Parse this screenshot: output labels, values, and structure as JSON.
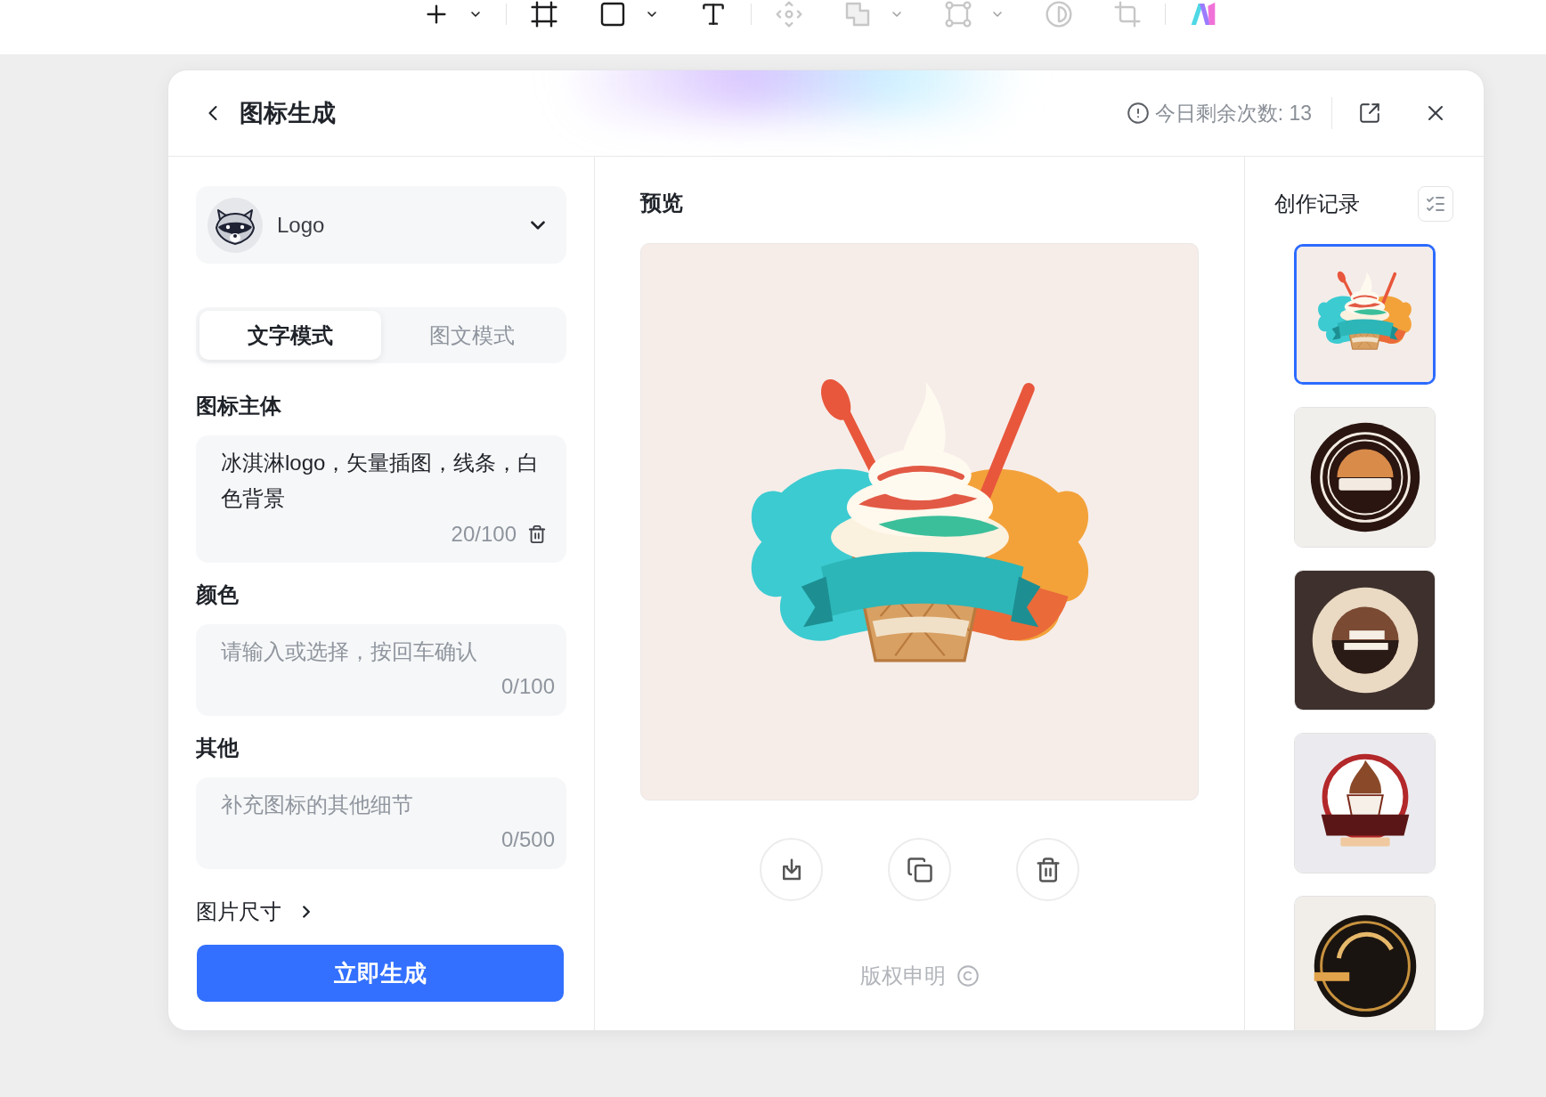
{
  "toolbar": {
    "groups": [
      {
        "tools": [
          {
            "menu": true,
            "disabled": false
          }
        ]
      },
      {
        "tools": [
          {
            "disabled": false
          },
          {
            "menu": true,
            "disabled": false
          },
          {
            "disabled": false
          }
        ]
      },
      {
        "tools": [
          {
            "disabled": true
          },
          {
            "menu": true,
            "disabled": true
          },
          {
            "menu": true,
            "disabled": true
          },
          {
            "disabled": true
          },
          {
            "disabled": true
          }
        ]
      },
      {
        "tools": [
          {
            "disabled": false
          }
        ]
      }
    ]
  },
  "dialog": {
    "title": "图标生成",
    "quota": "今日剩余次数: 13"
  },
  "form": {
    "style_select": {
      "value": "Logo"
    },
    "mode_tabs": [
      {
        "label": "文字模式",
        "selected": true
      },
      {
        "label": "图文模式",
        "selected": false
      }
    ],
    "fields": [
      {
        "label": "图标主体",
        "value": "冰淇淋logo，矢量插图，线条，白色背景",
        "counter": "20/100",
        "clearable": true
      },
      {
        "label": "颜色",
        "placeholder": "请输入或选择，按回车确认",
        "counter": "0/100"
      },
      {
        "label": "其他",
        "placeholder": "补充图标的其他细节",
        "counter": "0/500"
      }
    ],
    "size_option": {
      "label": "图片尺寸"
    },
    "generate_button": "立即生成"
  },
  "preview": {
    "title": "预览",
    "copyright": "版权申明"
  },
  "history": {
    "title": "创作记录",
    "items": [
      {
        "selected": true
      },
      {
        "selected": false
      },
      {
        "selected": false
      },
      {
        "selected": false
      },
      {
        "selected": false
      }
    ]
  }
}
